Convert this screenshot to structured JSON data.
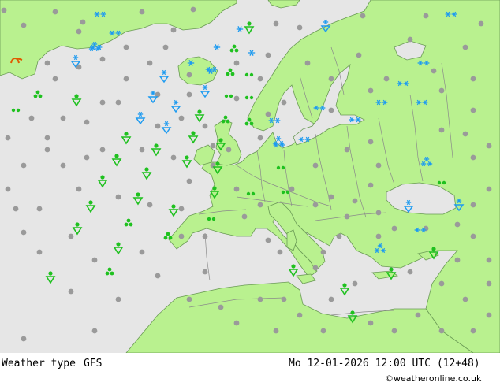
{
  "footer": {
    "label": "Weather type",
    "model": "GFS",
    "datetime": "Mo 12-01-2026 12:00 UTC (12+48)",
    "credit": "©weatheronline.co.uk"
  },
  "colors": {
    "sea": "#e6e6e6",
    "land": "#b9f18f",
    "border": "#8a8a8a",
    "coast": "#6a9a55",
    "rain": "#1fc11f",
    "snow": "#1e9bf0",
    "dry": "#9a9a9a"
  },
  "symbols": {
    "dry": "dot",
    "drizzle": "double-dot",
    "showers": "shower-triangle",
    "rain_showers": "trefoil",
    "snow": "snowflake",
    "heavy_snow": "snowflake-cluster",
    "snow_showers": "snow-shower-triangle"
  }
}
